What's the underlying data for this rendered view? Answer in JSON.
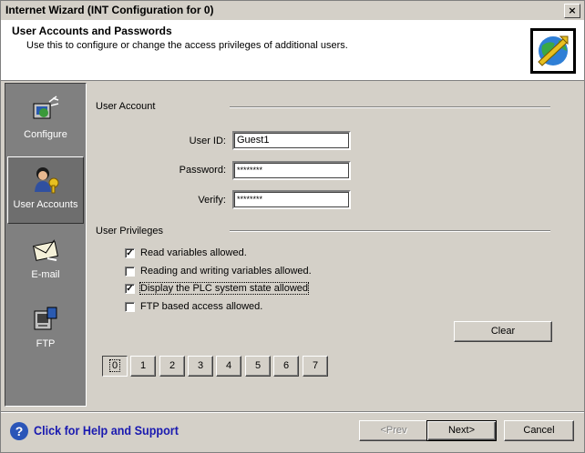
{
  "window": {
    "title": "Internet Wizard (INT Configuration for 0)",
    "close_glyph": "×"
  },
  "header": {
    "title": "User Accounts and Passwords",
    "subtitle": "Use this to configure or change the access privileges of additional users.",
    "logo_icon": "globe-wizard-icon"
  },
  "sidebar": {
    "items": [
      {
        "label": "Configure",
        "icon": "configure-icon",
        "selected": false
      },
      {
        "label": "User Accounts",
        "icon": "user-accounts-icon",
        "selected": true
      },
      {
        "label": "E-mail",
        "icon": "email-icon",
        "selected": false
      },
      {
        "label": "FTP",
        "icon": "ftp-icon",
        "selected": false
      }
    ]
  },
  "user_account": {
    "group_label": "User Account",
    "user_id_label": "User ID:",
    "user_id_value": "Guest1",
    "password_label": "Password:",
    "password_value": "********",
    "verify_label": "Verify:",
    "verify_value": "********"
  },
  "privileges": {
    "group_label": "User Privileges",
    "items": [
      {
        "label": "Read variables allowed.",
        "checked": true
      },
      {
        "label": "Reading and writing variables allowed.",
        "checked": false
      },
      {
        "label": "Display the PLC system state allowed",
        "checked": true
      },
      {
        "label": "FTP based access allowed.",
        "checked": false
      }
    ],
    "check_mark": "✓"
  },
  "clear_label": "Clear",
  "user_slots": [
    "0",
    "1",
    "2",
    "3",
    "4",
    "5",
    "6",
    "7"
  ],
  "selected_slot": "0",
  "footer": {
    "help_icon": "?",
    "help_text": "Click for Help and Support",
    "prev_label": "<Prev",
    "next_label": "Next>",
    "cancel_label": "Cancel"
  },
  "colors": {
    "dialog_bg": "#d4d0c8",
    "sidebar_bg": "#808080",
    "help_text": "#1a1ab0"
  }
}
